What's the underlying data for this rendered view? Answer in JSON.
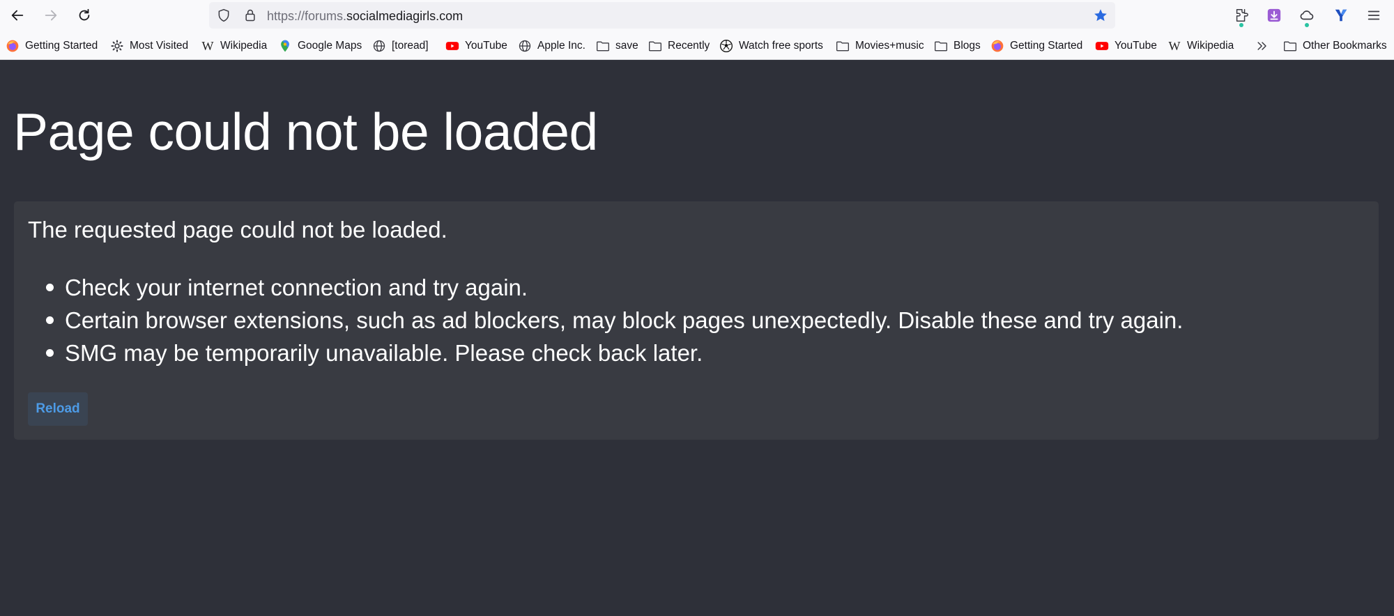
{
  "browser": {
    "url_protocol": "https://forums.",
    "url_domain": "socialmediagirls.com"
  },
  "bookmarks": [
    {
      "label": "Getting Started",
      "icon": "firefox-icon"
    },
    {
      "label": "Most Visited",
      "icon": "gear-icon"
    },
    {
      "label": "Wikipedia",
      "icon": "wikipedia-icon"
    },
    {
      "label": "Google Maps",
      "icon": "map-pin-icon"
    },
    {
      "label": "[toread]",
      "icon": "globe-icon"
    },
    {
      "label": "YouTube",
      "icon": "youtube-icon"
    },
    {
      "label": "Apple Inc.",
      "icon": "globe-icon"
    },
    {
      "label": "save",
      "icon": "folder-icon"
    },
    {
      "label": "Recently",
      "icon": "folder-icon"
    },
    {
      "label": "Watch free sports",
      "icon": "soccer-ball-icon"
    },
    {
      "label": "Movies+music",
      "icon": "folder-icon"
    },
    {
      "label": "Blogs",
      "icon": "folder-icon"
    },
    {
      "label": "Getting Started",
      "icon": "firefox-icon"
    },
    {
      "label": "YouTube",
      "icon": "youtube-icon"
    },
    {
      "label": "Wikipedia",
      "icon": "wikipedia-icon"
    }
  ],
  "other_bookmarks": "Other Bookmarks",
  "page": {
    "title": "Page could not be loaded",
    "lead": "The requested page could not be loaded.",
    "reasons": [
      "Check your internet connection and try again.",
      "Certain browser extensions, such as ad blockers, may block pages unexpectedly. Disable these and try again.",
      "SMG may be temporarily unavailable. Please check back later."
    ],
    "reload_label": "Reload"
  },
  "colors": {
    "page_bg": "#2e3039",
    "card_bg": "#393b42",
    "reload_text": "#4d9be6",
    "star": "#2a6ae0"
  }
}
